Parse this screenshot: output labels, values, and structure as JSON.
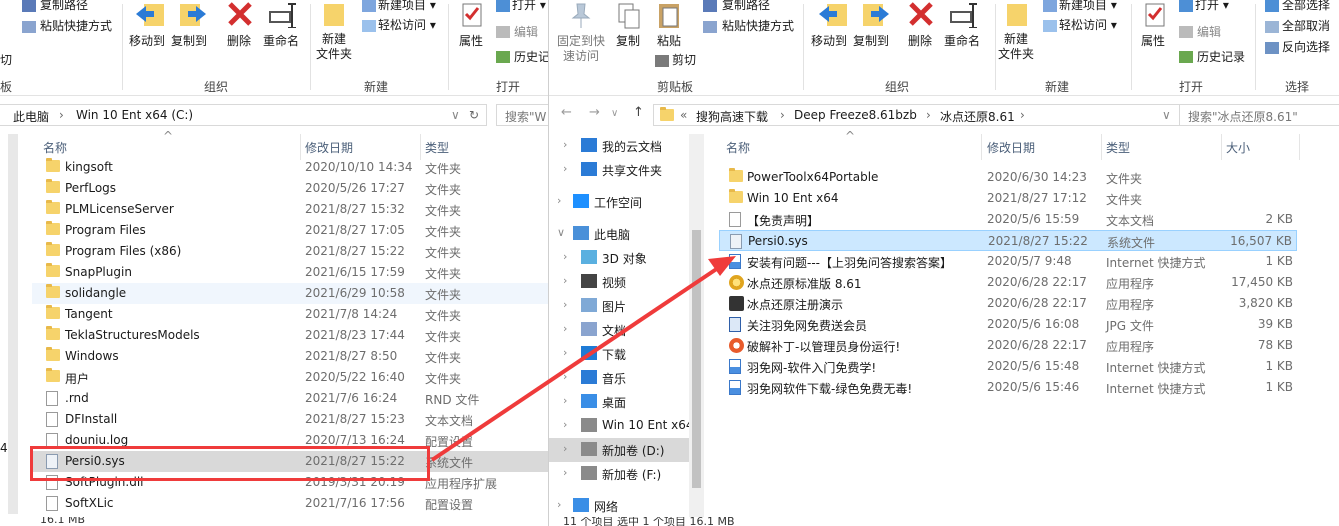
{
  "left": {
    "ribbon": {
      "copy_path": "复制路径",
      "paste_shortcut": "粘贴快捷方式",
      "move_to": "移动到",
      "copy_to": "复制到",
      "delete": "删除",
      "rename": "重命名",
      "new_folder_1": "新建",
      "new_folder_2": "文件夹",
      "new_item": "新建项目",
      "easy_access": "轻松访问",
      "properties": "属性",
      "open": "打开",
      "edit": "编辑",
      "history": "历史记",
      "cut_partial": "切",
      "group_clipboard_partial": "板",
      "group_organize": "组织",
      "group_new": "新建",
      "group_open": "打开"
    },
    "address": {
      "crumb1": "此电脑",
      "sep": "›",
      "crumb2": "Win 10 Ent x64 (C:)",
      "search": "搜索\"W"
    },
    "columns": {
      "name": "名称",
      "modified": "修改日期",
      "type": "类型"
    },
    "files": [
      {
        "name": "kingsoft",
        "date": "2020/10/10 14:34",
        "type": "文件夹",
        "icon": "folder"
      },
      {
        "name": "PerfLogs",
        "date": "2020/5/26 17:27",
        "type": "文件夹",
        "icon": "folder"
      },
      {
        "name": "PLMLicenseServer",
        "date": "2021/8/27 15:32",
        "type": "文件夹",
        "icon": "folder"
      },
      {
        "name": "Program Files",
        "date": "2021/8/27 17:05",
        "type": "文件夹",
        "icon": "folder"
      },
      {
        "name": "Program Files (x86)",
        "date": "2021/8/27 15:22",
        "type": "文件夹",
        "icon": "folder"
      },
      {
        "name": "SnapPlugin",
        "date": "2021/6/15 17:59",
        "type": "文件夹",
        "icon": "folder"
      },
      {
        "name": "solidangle",
        "date": "2021/6/29 10:58",
        "type": "文件夹",
        "icon": "folder"
      },
      {
        "name": "Tangent",
        "date": "2021/7/8 14:24",
        "type": "文件夹",
        "icon": "folder"
      },
      {
        "name": "TeklaStructuresModels",
        "date": "2021/8/23 17:44",
        "type": "文件夹",
        "icon": "folder"
      },
      {
        "name": "Windows",
        "date": "2021/8/27 8:50",
        "type": "文件夹",
        "icon": "folder"
      },
      {
        "name": "用户",
        "date": "2020/5/22 16:40",
        "type": "文件夹",
        "icon": "folder"
      },
      {
        "name": ".rnd",
        "date": "2021/7/6 16:24",
        "type": "RND 文件",
        "icon": "file"
      },
      {
        "name": "DFInstall",
        "date": "2021/8/27 15:23",
        "type": "文本文档",
        "icon": "file"
      },
      {
        "name": "douniu.log",
        "date": "2020/7/13 16:24",
        "type": "配置设置",
        "icon": "file"
      },
      {
        "name": "Persi0.sys",
        "date": "2021/8/27 15:22",
        "type": "系统文件",
        "icon": "sys"
      },
      {
        "name": "SoftPlugin.dll",
        "date": "2019/3/31 20:19",
        "type": "应用程序扩展",
        "icon": "file"
      },
      {
        "name": "SoftXLic",
        "date": "2021/7/16 17:56",
        "type": "配置设置",
        "icon": "file"
      }
    ],
    "status": "16.1 MB",
    "edge_digit": "4"
  },
  "right": {
    "ribbon": {
      "pin_1": "固定到快",
      "pin_2": "速访问",
      "copy": "复制",
      "paste": "粘贴",
      "copy_path": "复制路径",
      "paste_shortcut": "粘贴快捷方式",
      "cut": "剪切",
      "move_to": "移动到",
      "copy_to": "复制到",
      "delete": "删除",
      "rename": "重命名",
      "new_folder_1": "新建",
      "new_folder_2": "文件夹",
      "new_item": "新建项目",
      "easy_access": "轻松访问",
      "properties": "属性",
      "open": "打开",
      "edit": "编辑",
      "history": "历史记录",
      "select_all": "全部选择",
      "select_none": "全部取消",
      "invert": "反向选择",
      "group_clipboard": "剪贴板",
      "group_organize": "组织",
      "group_new": "新建",
      "group_open": "打开",
      "group_select": "选择"
    },
    "address": {
      "prefix": "«",
      "crumb1": "搜狗高速下载",
      "crumb2": "Deep Freeze8.61bzb",
      "crumb3": "冰点还原8.61",
      "sep": "›",
      "search": "搜索\"冰点还原8.61\""
    },
    "nav": [
      {
        "label": "我的云文档",
        "icon": "cloud"
      },
      {
        "label": "共享文件夹",
        "icon": "share"
      },
      {
        "label": "工作空间",
        "icon": "workspace"
      },
      {
        "label": "此电脑",
        "icon": "pc"
      },
      {
        "label": "3D 对象",
        "icon": "3d"
      },
      {
        "label": "视频",
        "icon": "video"
      },
      {
        "label": "图片",
        "icon": "pictures"
      },
      {
        "label": "文档",
        "icon": "docs"
      },
      {
        "label": "下载",
        "icon": "download"
      },
      {
        "label": "音乐",
        "icon": "music"
      },
      {
        "label": "桌面",
        "icon": "desktop"
      },
      {
        "label": "Win 10 Ent x64",
        "icon": "drive"
      },
      {
        "label": "新加卷 (D:)",
        "icon": "drive"
      },
      {
        "label": "新加卷 (F:)",
        "icon": "drive"
      },
      {
        "label": "网络",
        "icon": "network"
      }
    ],
    "columns": {
      "name": "名称",
      "modified": "修改日期",
      "type": "类型",
      "size": "大小"
    },
    "files": [
      {
        "name": "PowerToolx64Portable",
        "date": "2020/6/30 14:23",
        "type": "文件夹",
        "size": "",
        "icon": "folder"
      },
      {
        "name": "Win 10 Ent x64",
        "date": "2021/8/27 17:12",
        "type": "文件夹",
        "size": "",
        "icon": "folder"
      },
      {
        "name": "【免责声明】",
        "date": "2020/5/6 15:59",
        "type": "文本文档",
        "size": "2 KB",
        "icon": "file"
      },
      {
        "name": "Persi0.sys",
        "date": "2021/8/27 15:22",
        "type": "系统文件",
        "size": "16,507 KB",
        "icon": "sys"
      },
      {
        "name": "安装有问题---【上羽免问答搜索答案】",
        "date": "2020/5/7 9:48",
        "type": "Internet 快捷方式",
        "size": "1 KB",
        "icon": "url"
      },
      {
        "name": "冰点还原标准版 8.61",
        "date": "2020/6/28 22:17",
        "type": "应用程序",
        "size": "17,450 KB",
        "icon": "app"
      },
      {
        "name": "冰点还原注册演示",
        "date": "2020/6/28 22:17",
        "type": "应用程序",
        "size": "3,820 KB",
        "icon": "app2"
      },
      {
        "name": "关注羽免网免费送会员",
        "date": "2020/5/6 16:08",
        "type": "JPG 文件",
        "size": "39 KB",
        "icon": "jpg"
      },
      {
        "name": "破解补丁-以管理员身份运行!",
        "date": "2020/6/28 22:17",
        "type": "应用程序",
        "size": "78 KB",
        "icon": "app3"
      },
      {
        "name": "羽免网-软件入门免费学!",
        "date": "2020/5/6 15:48",
        "type": "Internet 快捷方式",
        "size": "1 KB",
        "icon": "url"
      },
      {
        "name": "羽免网软件下载-绿色免费无毒!",
        "date": "2020/5/6 15:46",
        "type": "Internet 快捷方式",
        "size": "1 KB",
        "icon": "url"
      }
    ],
    "status": "11 个项目    选中 1 个项目  16.1 MB"
  },
  "colors": {
    "highlight": "#ef3b3b",
    "selection": "#cce8ff",
    "folder": "#f6d36b",
    "accent": "#1e90ff"
  }
}
